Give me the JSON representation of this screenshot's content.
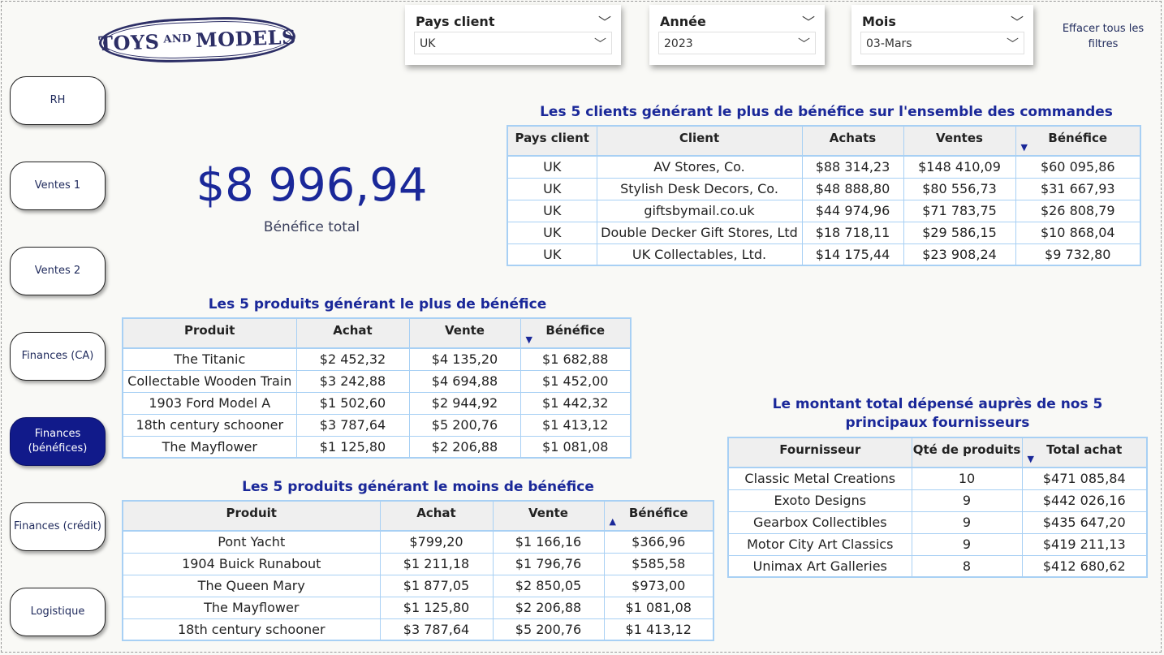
{
  "logo": {
    "word1": "TOYS",
    "word2": "AND",
    "word3": "MODELS"
  },
  "filters": {
    "country": {
      "title": "Pays client",
      "value": "UK"
    },
    "year": {
      "title": "Année",
      "value": "2023"
    },
    "month": {
      "title": "Mois",
      "value": "03-Mars"
    },
    "clear_all": "Effacer tous les filtres"
  },
  "nav": [
    "RH",
    "Ventes 1",
    "Ventes 2",
    "Finances (CA)",
    "Finances (bénéfices)",
    "Finances (crédit)",
    "Logistique"
  ],
  "nav_active": "Finances (bénéfices)",
  "kpi": {
    "value": "$8 996,94",
    "label": "Bénéfice total"
  },
  "top_clients": {
    "title": "Les 5 clients générant le plus de bénéfice sur l'ensemble des commandes",
    "headers": [
      "Pays client",
      "Client",
      "Achats",
      "Ventes",
      "Bénéfice"
    ],
    "rows": [
      [
        "UK",
        "AV Stores, Co.",
        "$88 314,23",
        "$148 410,09",
        "$60 095,86"
      ],
      [
        "UK",
        "Stylish Desk Decors, Co.",
        "$48 888,80",
        "$80 556,73",
        "$31 667,93"
      ],
      [
        "UK",
        "giftsbymail.co.uk",
        "$44 974,96",
        "$71 783,75",
        "$26 808,79"
      ],
      [
        "UK",
        "Double Decker Gift Stores, Ltd",
        "$18 718,11",
        "$29 586,15",
        "$10 868,04"
      ],
      [
        "UK",
        "UK Collectables, Ltd.",
        "$14 175,44",
        "$23 908,24",
        "$9 732,80"
      ]
    ]
  },
  "top_products": {
    "title": "Les 5 produits générant le plus de bénéfice",
    "headers": [
      "Produit",
      "Achat",
      "Vente",
      "Bénéfice"
    ],
    "rows": [
      [
        "The Titanic",
        "$2 452,32",
        "$4 135,20",
        "$1 682,88"
      ],
      [
        "Collectable Wooden Train",
        "$3 242,88",
        "$4 694,88",
        "$1 452,00"
      ],
      [
        "1903 Ford Model A",
        "$1 502,60",
        "$2 944,92",
        "$1 442,32"
      ],
      [
        "18th century schooner",
        "$3 787,64",
        "$5 200,76",
        "$1 413,12"
      ],
      [
        "The Mayflower",
        "$1 125,80",
        "$2 206,88",
        "$1 081,08"
      ]
    ]
  },
  "bottom_products": {
    "title": "Les 5 produits générant le moins de bénéfice",
    "headers": [
      "Produit",
      "Achat",
      "Vente",
      "Bénéfice"
    ],
    "rows": [
      [
        "Pont Yacht",
        "$799,20",
        "$1 166,16",
        "$366,96"
      ],
      [
        "1904 Buick Runabout",
        "$1 211,18",
        "$1 796,76",
        "$585,58"
      ],
      [
        "The Queen Mary",
        "$1 877,05",
        "$2 850,05",
        "$973,00"
      ],
      [
        "The Mayflower",
        "$1 125,80",
        "$2 206,88",
        "$1 081,08"
      ],
      [
        "18th century schooner",
        "$3 787,64",
        "$5 200,76",
        "$1 413,12"
      ]
    ]
  },
  "suppliers": {
    "title": "Le montant total dépensé auprès de nos 5 principaux fournisseurs",
    "headers": [
      "Fournisseur",
      "Qté de produits",
      "Total achat"
    ],
    "rows": [
      [
        "Classic Metal Creations",
        "10",
        "$471 085,84"
      ],
      [
        "Exoto Designs",
        "9",
        "$442 026,16"
      ],
      [
        "Gearbox Collectibles",
        "9",
        "$435 647,20"
      ],
      [
        "Motor City Art Classics",
        "9",
        "$419 211,13"
      ],
      [
        "Unimax Art Galleries",
        "8",
        "$412 680,62"
      ]
    ]
  },
  "icons": {
    "sort_desc": "sort-descending-icon",
    "sort_asc": "sort-ascending-icon",
    "dropdown": "chevron-down-icon"
  },
  "colors": {
    "accent": "#1a2899",
    "active_nav": "#111a8a",
    "table_border": "#a8d0f4",
    "header_bg": "#efefef"
  }
}
